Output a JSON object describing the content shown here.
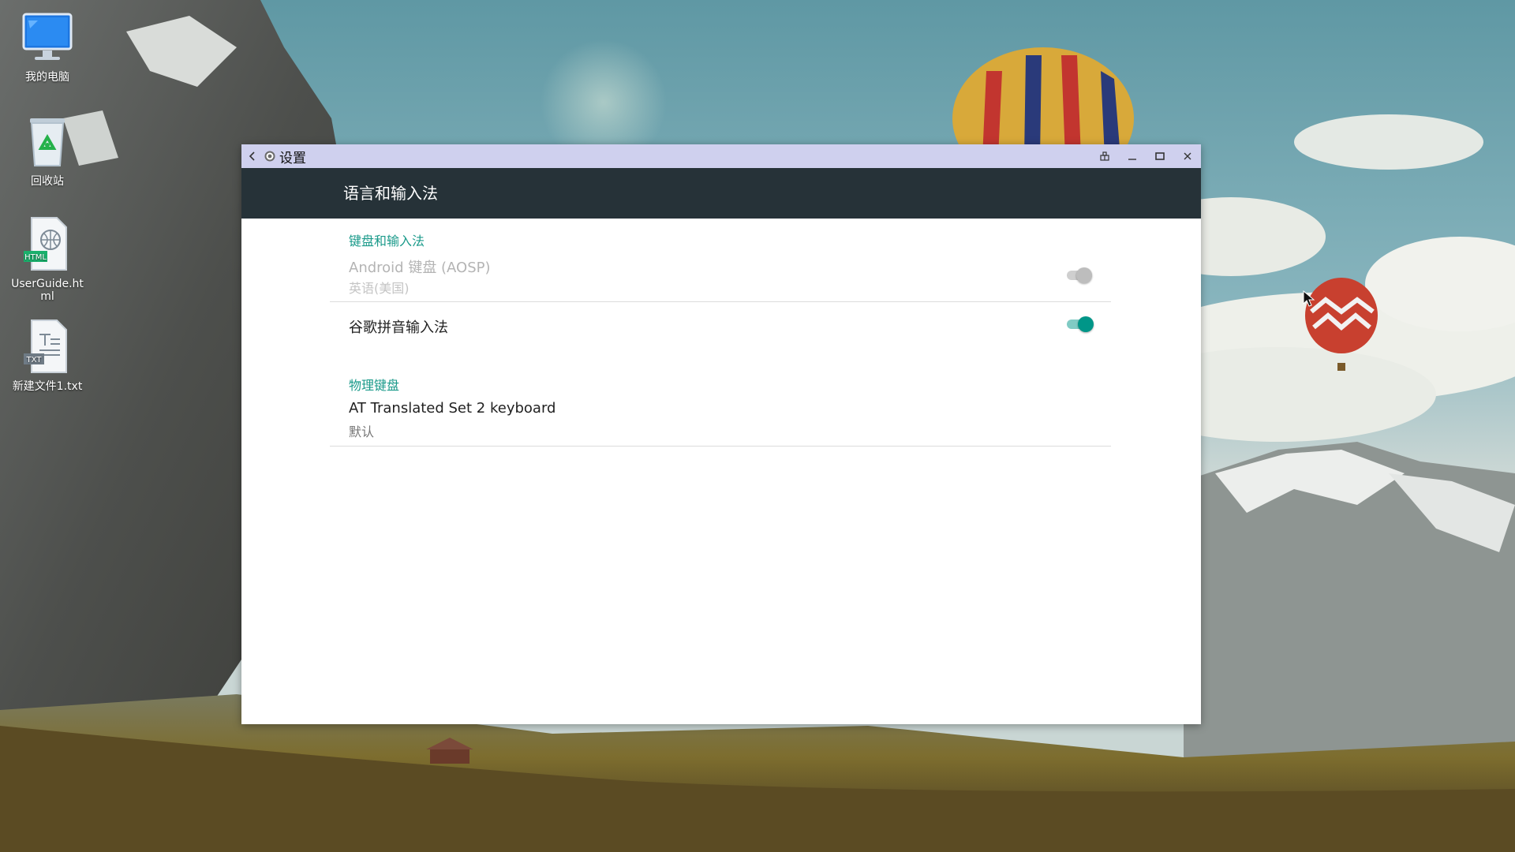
{
  "desktop": {
    "icons": [
      {
        "label": "我的电脑",
        "icon": "computer-icon"
      },
      {
        "label": "回收站",
        "icon": "recycle-bin-icon"
      },
      {
        "label": "UserGuide.html",
        "icon": "html-file-icon",
        "badge": "HTML"
      },
      {
        "label": "新建文件1.txt",
        "icon": "txt-file-icon",
        "badge": "TXT"
      }
    ]
  },
  "window": {
    "title": "设置",
    "back_icon": "chevron-left-icon",
    "app_icon": "settings-gear-icon",
    "controls": [
      "pin-icon",
      "minimize-icon",
      "maximize-icon",
      "close-icon"
    ],
    "titlebar_color": "#cfd0ee"
  },
  "appbar": {
    "title": "语言和输入法",
    "color": "#263238"
  },
  "sections": [
    {
      "header": "键盘和输入法",
      "items": [
        {
          "title": "Android 键盘 (AOSP)",
          "subtitle": "英语(美国)",
          "enabled": false,
          "switch_on": true
        },
        {
          "title": "谷歌拼音输入法",
          "subtitle": "",
          "enabled": true,
          "switch_on": true
        }
      ]
    },
    {
      "header": "物理键盘",
      "items": [
        {
          "title": "AT Translated Set 2 keyboard",
          "subtitle": "默认"
        }
      ]
    }
  ],
  "colors": {
    "accent": "#009688",
    "section_header": "#1a9a8a"
  }
}
